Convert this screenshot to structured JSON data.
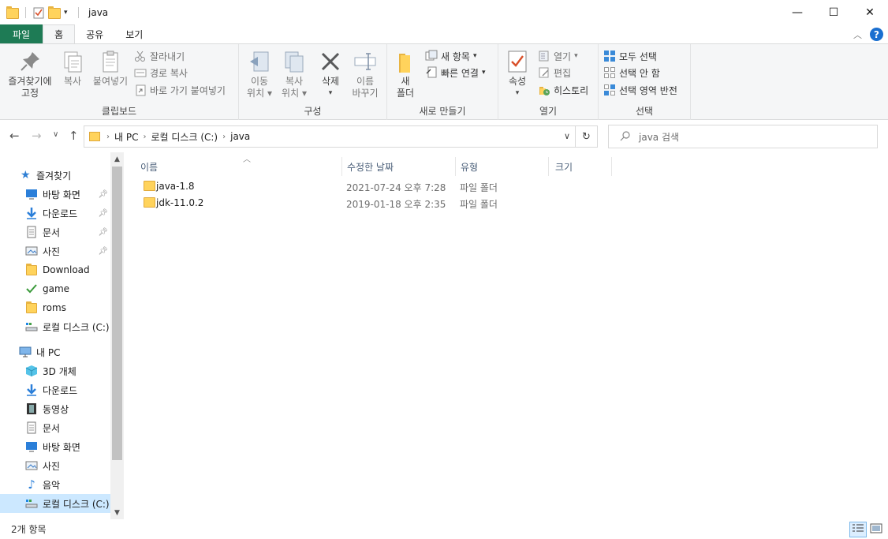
{
  "window": {
    "title": "java",
    "controls": {
      "minimize": "—",
      "maximize": "☐",
      "close": "✕"
    }
  },
  "ribbon_tabs": [
    {
      "label": "파일"
    },
    {
      "label": "홈"
    },
    {
      "label": "공유"
    },
    {
      "label": "보기"
    }
  ],
  "ribbon": {
    "clipboard": {
      "group_label": "클립보드",
      "pin_line1": "즐겨찾기에",
      "pin_line2": "고정",
      "copy": "복사",
      "paste": "붙여넣기",
      "cut": "잘라내기",
      "copy_path": "경로 복사",
      "paste_shortcut": "바로 가기 붙여넣기"
    },
    "organize": {
      "group_label": "구성",
      "move_line1": "이동",
      "move_line2": "위치",
      "copyto_line1": "복사",
      "copyto_line2": "위치",
      "delete": "삭제",
      "rename_line1": "이름",
      "rename_line2": "바꾸기"
    },
    "new": {
      "group_label": "새로 만들기",
      "new_folder_line1": "새",
      "new_folder_line2": "폴더",
      "new_item": "새 항목",
      "easy_access": "빠른 연결"
    },
    "open": {
      "group_label": "열기",
      "properties": "속성",
      "open": "열기",
      "edit": "편집",
      "history": "히스토리"
    },
    "select": {
      "group_label": "선택",
      "select_all": "모두 선택",
      "select_none": "선택 안 함",
      "invert": "선택 영역 반전"
    }
  },
  "address": {
    "segments": [
      "내 PC",
      "로컬 디스크 (C:)",
      "java"
    ],
    "search_placeholder": "java 검색"
  },
  "nav_pane": {
    "quick_access": "즐겨찾기",
    "quick_items": [
      {
        "label": "바탕 화면",
        "pinned": true
      },
      {
        "label": "다운로드",
        "pinned": true
      },
      {
        "label": "문서",
        "pinned": true
      },
      {
        "label": "사진",
        "pinned": true
      },
      {
        "label": "Download"
      },
      {
        "label": "game"
      },
      {
        "label": "roms"
      },
      {
        "label": "로컬 디스크 (C:)"
      }
    ],
    "this_pc": "내 PC",
    "pc_items": [
      {
        "label": "3D 개체"
      },
      {
        "label": "다운로드"
      },
      {
        "label": "동영상"
      },
      {
        "label": "문서"
      },
      {
        "label": "바탕 화면"
      },
      {
        "label": "사진"
      },
      {
        "label": "음악"
      },
      {
        "label": "로컬 디스크 (C:)"
      }
    ]
  },
  "file_list": {
    "columns": [
      "이름",
      "수정한 날짜",
      "유형",
      "크기"
    ],
    "rows": [
      {
        "name": "java-1.8",
        "modified": "2021-07-24 오후 7:28",
        "type": "파일 폴더",
        "size": ""
      },
      {
        "name": "jdk-11.0.2",
        "modified": "2019-01-18 오후 2:35",
        "type": "파일 폴더",
        "size": ""
      }
    ]
  },
  "status": {
    "item_count": "2개 항목"
  }
}
